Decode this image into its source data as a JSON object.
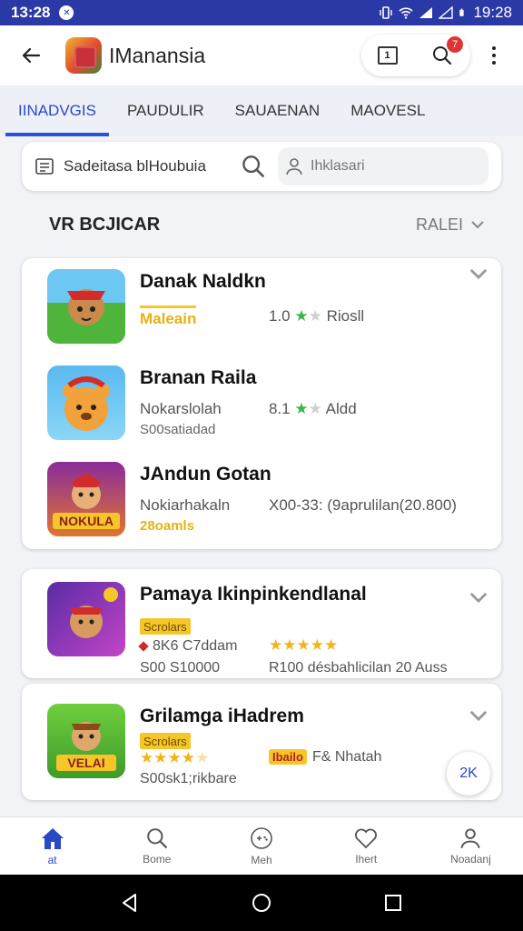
{
  "status_bar": {
    "time_left": "13:28",
    "notif_glyph": "✕",
    "time_right": "19:28"
  },
  "app_bar": {
    "title": "IManansia",
    "page_button_label": "1",
    "badge_count": "7"
  },
  "tabs": [
    {
      "label": "IINADVGIS",
      "active": true
    },
    {
      "label": "PAUDULIR",
      "active": false
    },
    {
      "label": "SAUAENAN",
      "active": false
    },
    {
      "label": "MAOVESL",
      "active": false
    }
  ],
  "search": {
    "label": "Sadeitasa blHoubuia",
    "placeholder": "Ihklasari"
  },
  "section": {
    "title": "VR BCJICAR",
    "sort_label": "RALEI"
  },
  "games": [
    {
      "title": "Danak Naldkn",
      "sub1": "Maleain",
      "rating": "1.0",
      "rating_text": "Riosll",
      "stars": [
        "g",
        "o"
      ]
    },
    {
      "title": "Branan Raila",
      "sub1": "Nokarslolah",
      "sub2": "S00satiadad",
      "rating": "8.1",
      "rating_text": "Aldd",
      "stars": [
        "g",
        "o"
      ]
    },
    {
      "title": "JAndun Gotan",
      "sub1": "Nokiarhakaln",
      "sub2": "28oamls",
      "rating_text": "X00-33: (9aprulilan(20.800)"
    },
    {
      "title": "Pamaya Ikinpinkendlanal",
      "chip": "Scrolars",
      "meta": "8K6 C7ddam",
      "sub2": "S00 S10000",
      "rating_text": "R100 désbahlicilan 20 Auss",
      "stars": [
        "f",
        "f",
        "f",
        "f",
        "f"
      ]
    },
    {
      "title": "Grilamga iHadrem",
      "chip": "Scrolars",
      "sub2": "S00sk1;rikbare",
      "ribbon": "Ibailo",
      "rating_text": "F& Nhatah",
      "stars": [
        "f",
        "f",
        "f",
        "f",
        "o"
      ]
    }
  ],
  "fab_label": "2K",
  "bottom_nav": [
    {
      "label": "at",
      "icon": "home-icon",
      "active": true
    },
    {
      "label": "Bome",
      "icon": "search-icon",
      "active": false
    },
    {
      "label": "Meh",
      "icon": "gamepad-icon",
      "active": false
    },
    {
      "label": "Ihert",
      "icon": "heart-icon",
      "active": false
    },
    {
      "label": "Noadanj",
      "icon": "person-icon",
      "active": false
    }
  ],
  "colors": {
    "accent": "#2a47c4",
    "status_bar": "#2a39a5",
    "star": "#f3b41b",
    "chip": "#f6c629"
  }
}
